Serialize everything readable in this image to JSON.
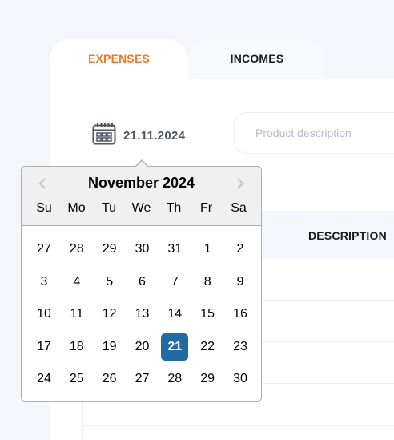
{
  "tabs": {
    "expenses": "EXPENSES",
    "incomes": "INCOMES"
  },
  "date_field": {
    "value": "21.11.2024",
    "icon": "calendar-icon"
  },
  "product_input": {
    "placeholder": "Product description",
    "value": ""
  },
  "table": {
    "columns": {
      "description": "DESCRIPTION"
    }
  },
  "calendar": {
    "month_title": "November 2024",
    "weekdays": [
      "Su",
      "Mo",
      "Tu",
      "We",
      "Th",
      "Fr",
      "Sa"
    ],
    "weeks": [
      [
        "27",
        "28",
        "29",
        "30",
        "31",
        "1",
        "2"
      ],
      [
        "3",
        "4",
        "5",
        "6",
        "7",
        "8",
        "9"
      ],
      [
        "10",
        "11",
        "12",
        "13",
        "14",
        "15",
        "16"
      ],
      [
        "17",
        "18",
        "19",
        "20",
        "21",
        "22",
        "23"
      ],
      [
        "24",
        "25",
        "26",
        "27",
        "28",
        "29",
        "30"
      ]
    ],
    "selected_day": "21",
    "selected_week_index": 3,
    "colors": {
      "selected_bg": "#216ba5",
      "header_bg": "#f0f0f0"
    }
  },
  "colors": {
    "accent": "#f0782a",
    "date_text": "#52555f"
  }
}
